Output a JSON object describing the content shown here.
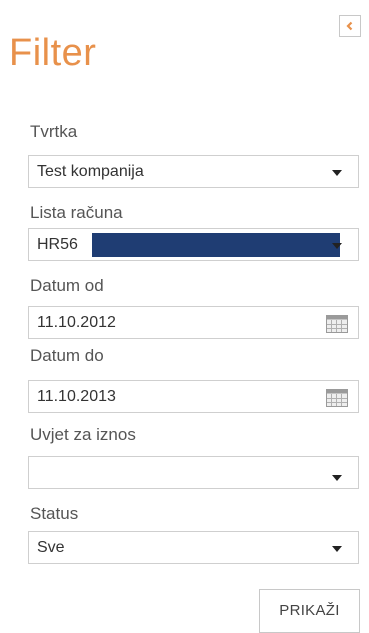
{
  "panel": {
    "title": "Filter",
    "collapse_icon": "chevron-left-icon",
    "accent_color": "#e8914b"
  },
  "fields": {
    "tvrtka": {
      "label": "Tvrtka",
      "value": "Test kompanija"
    },
    "lista_racuna": {
      "label": "Lista računa",
      "value": "HR56"
    },
    "datum_od": {
      "label": "Datum od",
      "value": "11.10.2012"
    },
    "datum_do": {
      "label": "Datum do",
      "value": "11.10.2013"
    },
    "uvjet_za_iznos": {
      "label": "Uvjet za iznos",
      "value": ""
    },
    "status": {
      "label": "Status",
      "value": "Sve"
    }
  },
  "actions": {
    "submit_label": "PRIKAŽI"
  }
}
